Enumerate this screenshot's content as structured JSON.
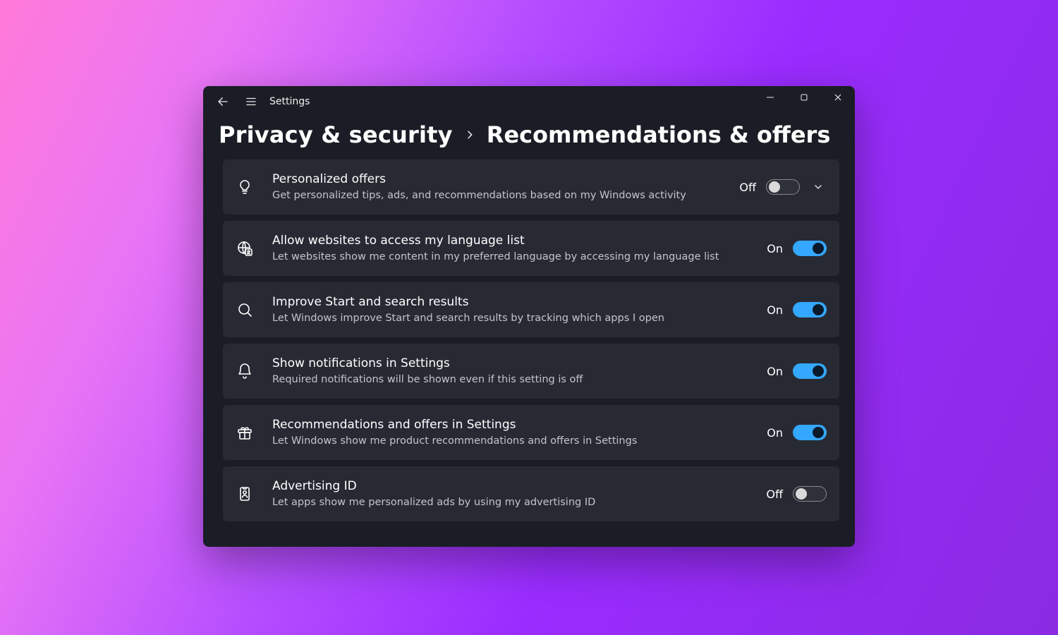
{
  "app_title": "Settings",
  "breadcrumb": {
    "parent": "Privacy & security",
    "leaf": "Recommendations & offers"
  },
  "state_labels": {
    "on": "On",
    "off": "Off"
  },
  "rows": [
    {
      "id": "personalized-offers",
      "icon": "lightbulb",
      "title": "Personalized offers",
      "desc": "Get personalized tips, ads, and recommendations based on my Windows activity",
      "state": "off",
      "expandable": true
    },
    {
      "id": "language-list",
      "icon": "globe-language",
      "title": "Allow websites to access my language list",
      "desc": "Let websites show me content in my preferred language by accessing my language list",
      "state": "on",
      "expandable": false
    },
    {
      "id": "improve-search",
      "icon": "search",
      "title": "Improve Start and search results",
      "desc": "Let Windows improve Start and search results by tracking which apps I open",
      "state": "on",
      "expandable": false
    },
    {
      "id": "notifications-in-settings",
      "icon": "bell",
      "title": "Show notifications in Settings",
      "desc": "Required notifications will be shown even if this setting is off",
      "state": "on",
      "expandable": false
    },
    {
      "id": "recs-in-settings",
      "icon": "gift",
      "title": "Recommendations and offers in Settings",
      "desc": "Let Windows show me product recommendations and offers in Settings",
      "state": "on",
      "expandable": false
    },
    {
      "id": "advertising-id",
      "icon": "id-card",
      "title": "Advertising ID",
      "desc": "Let apps show me personalized ads by using my advertising ID",
      "state": "off",
      "expandable": false
    }
  ]
}
